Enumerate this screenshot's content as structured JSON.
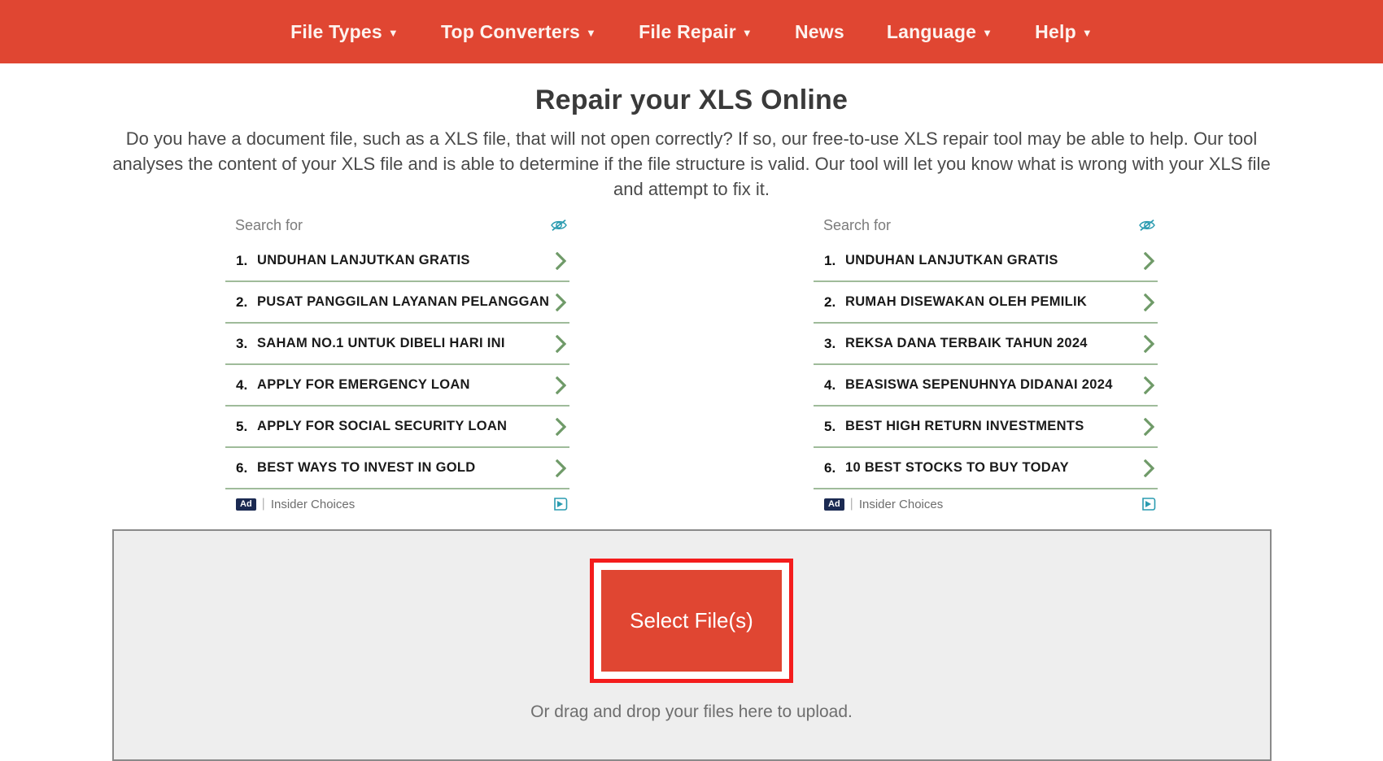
{
  "nav": {
    "items": [
      {
        "label": "File Types",
        "has_caret": true,
        "caret": "▼"
      },
      {
        "label": "Top Converters",
        "has_caret": true,
        "caret": "▼"
      },
      {
        "label": "File Repair",
        "has_caret": true,
        "caret": "▼"
      },
      {
        "label": "News",
        "has_caret": false,
        "caret": ""
      },
      {
        "label": "Language",
        "has_caret": true,
        "caret": "▼"
      },
      {
        "label": "Help",
        "has_caret": true,
        "caret": "▼"
      }
    ],
    "background_color": "#e04632",
    "text_color": "#fdf3ef"
  },
  "page": {
    "title": "Repair your XLS Online",
    "intro": "Do you have a document file, such as a XLS file, that will not open correctly? If so, our free-to-use XLS repair tool may be able to help. Our tool analyses the content of your XLS file and is able to determine if the file structure is valid. Our tool will let you know what is wrong with your XLS file and attempt to fix it."
  },
  "ads": [
    {
      "header_label": "Search for",
      "hide_icon": "eye-slash-icon",
      "items": [
        {
          "num": "1.",
          "text": "UNDUHAN LANJUTKAN GRATIS"
        },
        {
          "num": "2.",
          "text": "PUSAT PANGGILAN LAYANAN PELANGGAN"
        },
        {
          "num": "3.",
          "text": "SAHAM NO.1 UNTUK DIBELI HARI INI"
        },
        {
          "num": "4.",
          "text": "APPLY FOR EMERGENCY LOAN"
        },
        {
          "num": "5.",
          "text": "APPLY FOR SOCIAL SECURITY LOAN"
        },
        {
          "num": "6.",
          "text": "BEST WAYS TO INVEST IN GOLD"
        }
      ],
      "footer": {
        "badge": "Ad",
        "separator": "|",
        "provider": "Insider Choices",
        "choices_icon": "adchoices-icon"
      }
    },
    {
      "header_label": "Search for",
      "hide_icon": "eye-slash-icon",
      "items": [
        {
          "num": "1.",
          "text": "UNDUHAN LANJUTKAN GRATIS"
        },
        {
          "num": "2.",
          "text": "RUMAH DISEWAKAN OLEH PEMILIK"
        },
        {
          "num": "3.",
          "text": "REKSA DANA TERBAIK TAHUN 2024"
        },
        {
          "num": "4.",
          "text": "BEASISWA SEPENUHNYA DIDANAI 2024"
        },
        {
          "num": "5.",
          "text": "BEST HIGH RETURN INVESTMENTS"
        },
        {
          "num": "6.",
          "text": "10 BEST STOCKS TO BUY TODAY"
        }
      ],
      "footer": {
        "badge": "Ad",
        "separator": "|",
        "provider": "Insider Choices",
        "choices_icon": "adchoices-icon"
      }
    }
  ],
  "upload": {
    "select_button_label": "Select File(s)",
    "drop_hint": "Or drag and drop your files here to upload.",
    "button_color": "#e04632",
    "highlight_color": "#f41c1c",
    "zone_background": "#eeeeee",
    "zone_border_color": "#8a8a8a"
  },
  "colors": {
    "accent_red": "#e04632",
    "ad_divider_green": "#9fbb9a",
    "chevron_green": "#6f9a68",
    "icon_teal": "#2a9bb0",
    "ad_badge_navy": "#1b2a52"
  }
}
